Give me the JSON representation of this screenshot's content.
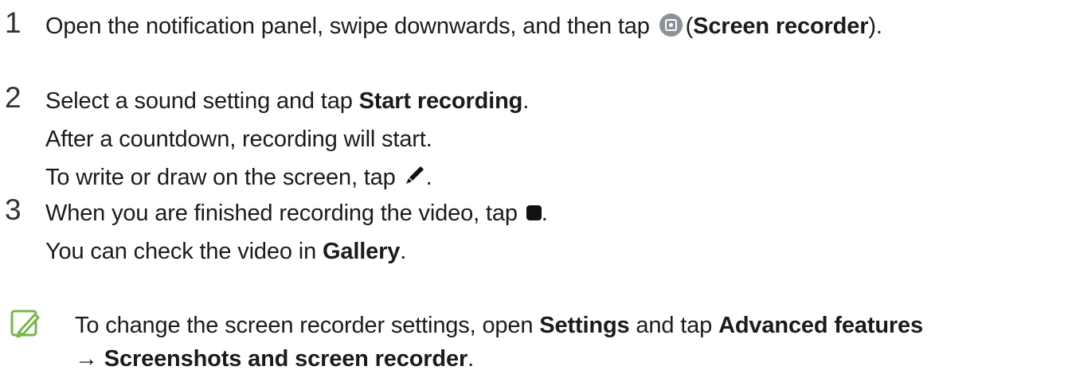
{
  "steps": [
    {
      "number": "1",
      "line1_pre": "Open the notification panel, swipe downwards, and then tap",
      "line1_open": "(",
      "line1_bold": "Screen recorder",
      "line1_post": ")."
    },
    {
      "number": "2",
      "line1_pre": "Select a sound setting and tap",
      "line1_bold": "Start recording",
      "line1_post": ".",
      "line2": "After a countdown, recording will start.",
      "line3_pre": "To write or draw on the screen, tap",
      "line3_post": "."
    },
    {
      "number": "3",
      "line1_pre": "When you are finished recording the video, tap",
      "line1_post": ".",
      "line2_pre": "You can check the video in",
      "line2_bold": "Gallery",
      "line2_post": "."
    }
  ],
  "note": {
    "icon": "note-pencil-icon",
    "pre": "To change the screen recorder settings, open",
    "bold1": "Settings",
    "mid": "and tap",
    "bold2": "Advanced features",
    "arrow": "→",
    "bold3": "Screenshots and screen recorder",
    "post": "."
  },
  "colors": {
    "note_icon": "#7ab648",
    "recorder_icon_bg": "#8d9199",
    "text": "#1b1b1b"
  }
}
